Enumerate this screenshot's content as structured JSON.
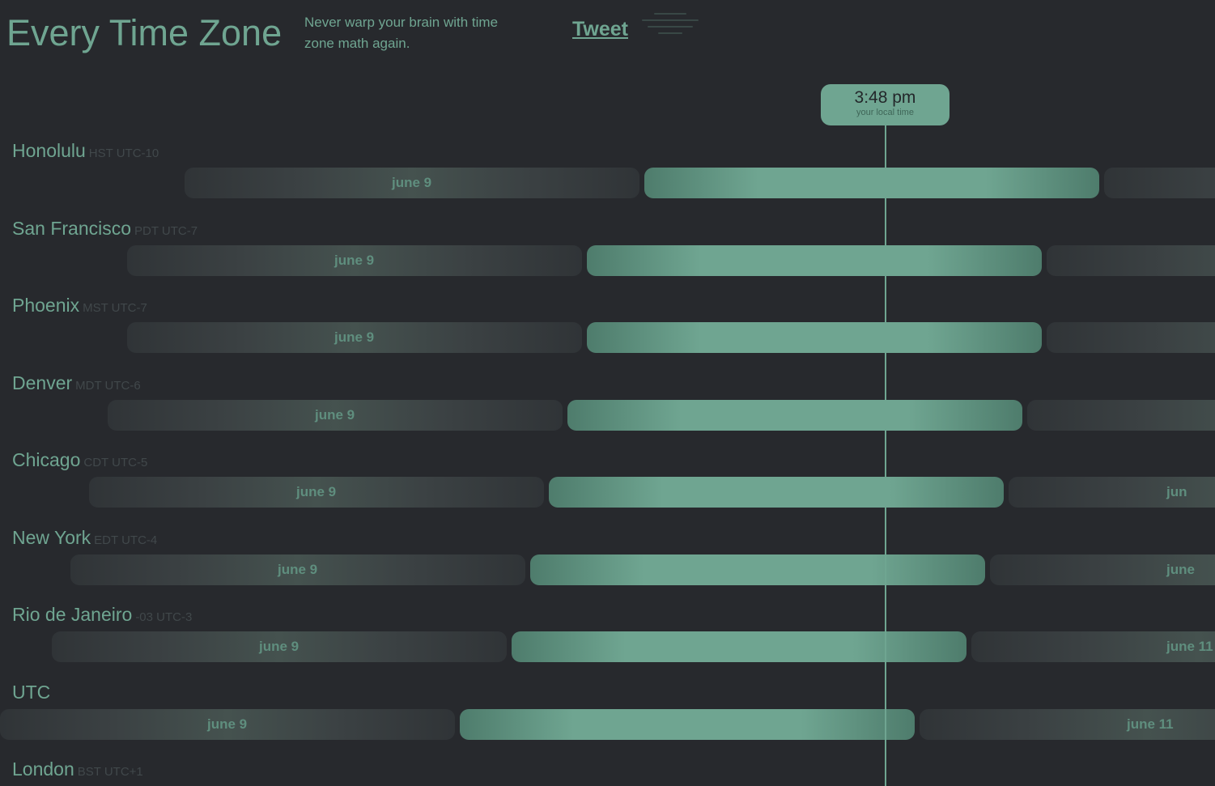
{
  "header": {
    "title": "Every Time Zone",
    "tagline": "Never warp your brain with time zone math again.",
    "tweet_label": "Tweet"
  },
  "now": {
    "time": "3:48 pm",
    "label": "your local time"
  },
  "timezones": [
    {
      "city": "Honolulu",
      "abbr": "HST UTC-10",
      "days": [
        "june 9",
        "",
        ""
      ]
    },
    {
      "city": "San Francisco",
      "abbr": "PDT UTC-7",
      "days": [
        "june 9",
        "",
        ""
      ]
    },
    {
      "city": "Phoenix",
      "abbr": "MST UTC-7",
      "days": [
        "june 9",
        "",
        ""
      ]
    },
    {
      "city": "Denver",
      "abbr": "MDT UTC-6",
      "days": [
        "june 9",
        "",
        ""
      ]
    },
    {
      "city": "Chicago",
      "abbr": "CDT UTC-5",
      "days": [
        "june 9",
        "",
        "jun"
      ]
    },
    {
      "city": "New York",
      "abbr": "EDT UTC-4",
      "days": [
        "june 9",
        "",
        "june"
      ]
    },
    {
      "city": "Rio de Janeiro",
      "abbr": "-03 UTC-3",
      "days": [
        "june 9",
        "",
        "june 11"
      ]
    },
    {
      "city": "UTC",
      "abbr": "",
      "days": [
        "june 9",
        "",
        "june 11"
      ]
    },
    {
      "city": "London",
      "abbr": "BST UTC+1",
      "days": []
    }
  ],
  "colors": {
    "background": "#27292d",
    "accent": "#6fa591",
    "muted": "#41484b"
  }
}
